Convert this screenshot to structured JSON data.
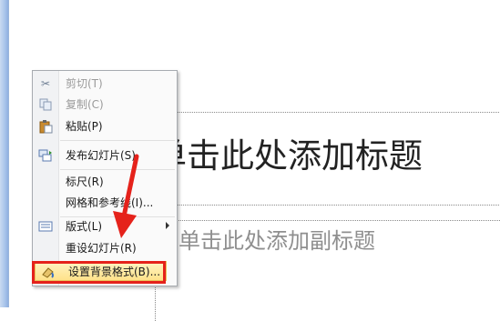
{
  "slide": {
    "title_placeholder": "单击此处添加标题",
    "subtitle_placeholder": "单击此处添加副标题"
  },
  "context_menu": {
    "items": [
      {
        "label": "剪切(T)",
        "icon": "scissors-icon",
        "enabled": false
      },
      {
        "label": "复制(C)",
        "icon": "copy-icon",
        "enabled": false
      },
      {
        "label": "粘贴(P)",
        "icon": "paste-icon",
        "enabled": true
      },
      {
        "label": "发布幻灯片(S)",
        "icon": "publish-slides-icon",
        "enabled": true
      },
      {
        "label": "标尺(R)",
        "icon": "",
        "enabled": true
      },
      {
        "label": "网格和参考线(I)...",
        "icon": "",
        "enabled": true
      },
      {
        "label": "版式(L)",
        "icon": "layout-icon",
        "enabled": true,
        "submenu": true
      },
      {
        "label": "重设幻灯片(R)",
        "icon": "",
        "enabled": true
      },
      {
        "label": "设置背景格式(B)...",
        "icon": "format-background-icon",
        "enabled": true,
        "highlighted": true
      }
    ]
  },
  "annotation": {
    "highlight_color": "#e5221b",
    "arrow_color": "#e5221b"
  }
}
